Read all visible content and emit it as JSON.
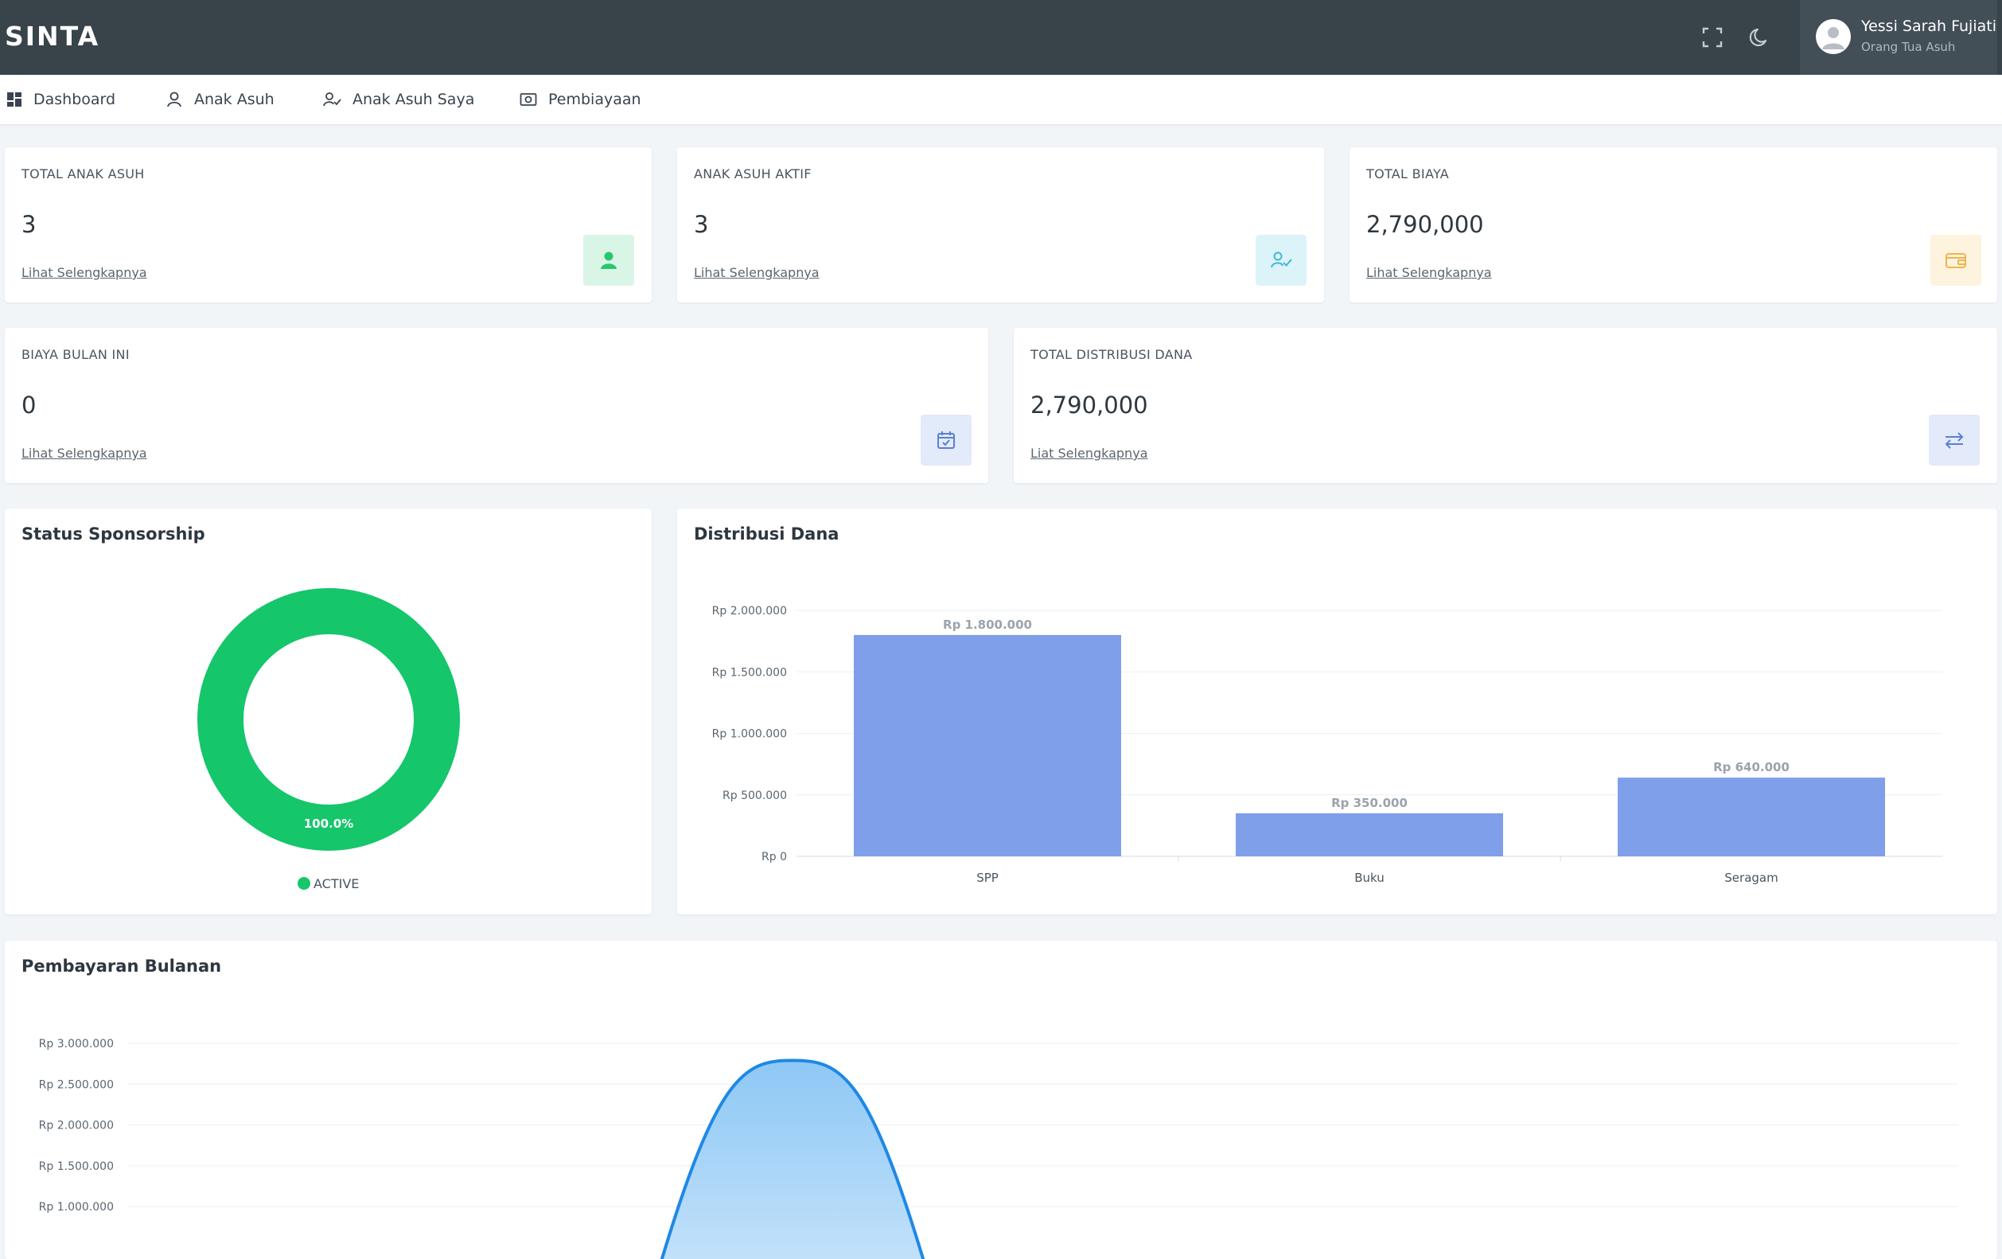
{
  "app": {
    "title": "SINTA"
  },
  "user": {
    "name": "Yessi Sarah Fujiati",
    "role": "Orang Tua Asuh"
  },
  "nav": {
    "items": [
      {
        "label": "Dashboard",
        "icon": "dashboard-icon"
      },
      {
        "label": "Anak Asuh",
        "icon": "user-icon"
      },
      {
        "label": "Anak Asuh Saya",
        "icon": "user-check-icon"
      },
      {
        "label": "Pembiayaan",
        "icon": "money-icon"
      }
    ]
  },
  "stats": [
    {
      "label": "TOTAL ANAK ASUH",
      "value": "3",
      "link": "Lihat Selengkapnya",
      "icon": "user-icon",
      "color": "#28c76f"
    },
    {
      "label": "ANAK ASUH AKTIF",
      "value": "3",
      "link": "Lihat Selengkapnya",
      "icon": "user-check-icon",
      "color": "#3fb8d6"
    },
    {
      "label": "TOTAL BIAYA",
      "value": "2,790,000",
      "link": "Lihat Selengkapnya",
      "icon": "wallet-icon",
      "color": "#f0b44c"
    },
    {
      "label": "BIAYA BULAN INI",
      "value": "0",
      "link": "Lihat Selengkapnya",
      "icon": "calendar-check-icon",
      "color": "#5b7fd6"
    },
    {
      "label": "TOTAL DISTRIBUSI DANA",
      "value": "2,790,000",
      "link": "Liat Selengkapnya",
      "icon": "transfer-icon",
      "color": "#5b7fd6"
    }
  ],
  "charts": {
    "status": {
      "title": "Status Sponsorship"
    },
    "distribusi": {
      "title": "Distribusi Dana"
    },
    "pembayaran": {
      "title": "Pembayaran Bulanan"
    }
  },
  "chart_data": [
    {
      "type": "pie",
      "title": "Status Sponsorship",
      "categories": [
        "ACTIVE"
      ],
      "values": [
        100
      ],
      "data_labels": [
        "100.0%"
      ],
      "colors": [
        "#15c66b"
      ],
      "legend": "bottom"
    },
    {
      "type": "bar",
      "title": "Distribusi Dana",
      "categories": [
        "SPP",
        "Buku",
        "Seragam"
      ],
      "values": [
        1800000,
        350000,
        640000
      ],
      "data_labels": [
        "Rp 1.800.000",
        "Rp 350.000",
        "Rp 640.000"
      ],
      "ylim": [
        0,
        2000000
      ],
      "y_ticks": [
        0,
        500000,
        1000000,
        1500000,
        2000000
      ],
      "y_tick_labels": [
        "Rp 0",
        "Rp 500.000",
        "Rp 1.000.000",
        "Rp 1.500.000",
        "Rp 2.000.000"
      ],
      "grid": true,
      "color": "#7f9fea"
    },
    {
      "type": "area",
      "title": "Pembayaran Bulanan",
      "x": [
        0,
        1,
        2
      ],
      "values": [
        0,
        2790000,
        0
      ],
      "ylim": [
        0,
        3000000
      ],
      "y_ticks": [
        1000000,
        1500000,
        2000000,
        2500000,
        3000000
      ],
      "y_tick_labels": [
        "Rp 1.000.000",
        "Rp 1.500.000",
        "Rp 2.000.000",
        "Rp 2.500.000",
        "Rp 3.000.000"
      ],
      "grid": true,
      "color": "#1e88e5"
    }
  ]
}
